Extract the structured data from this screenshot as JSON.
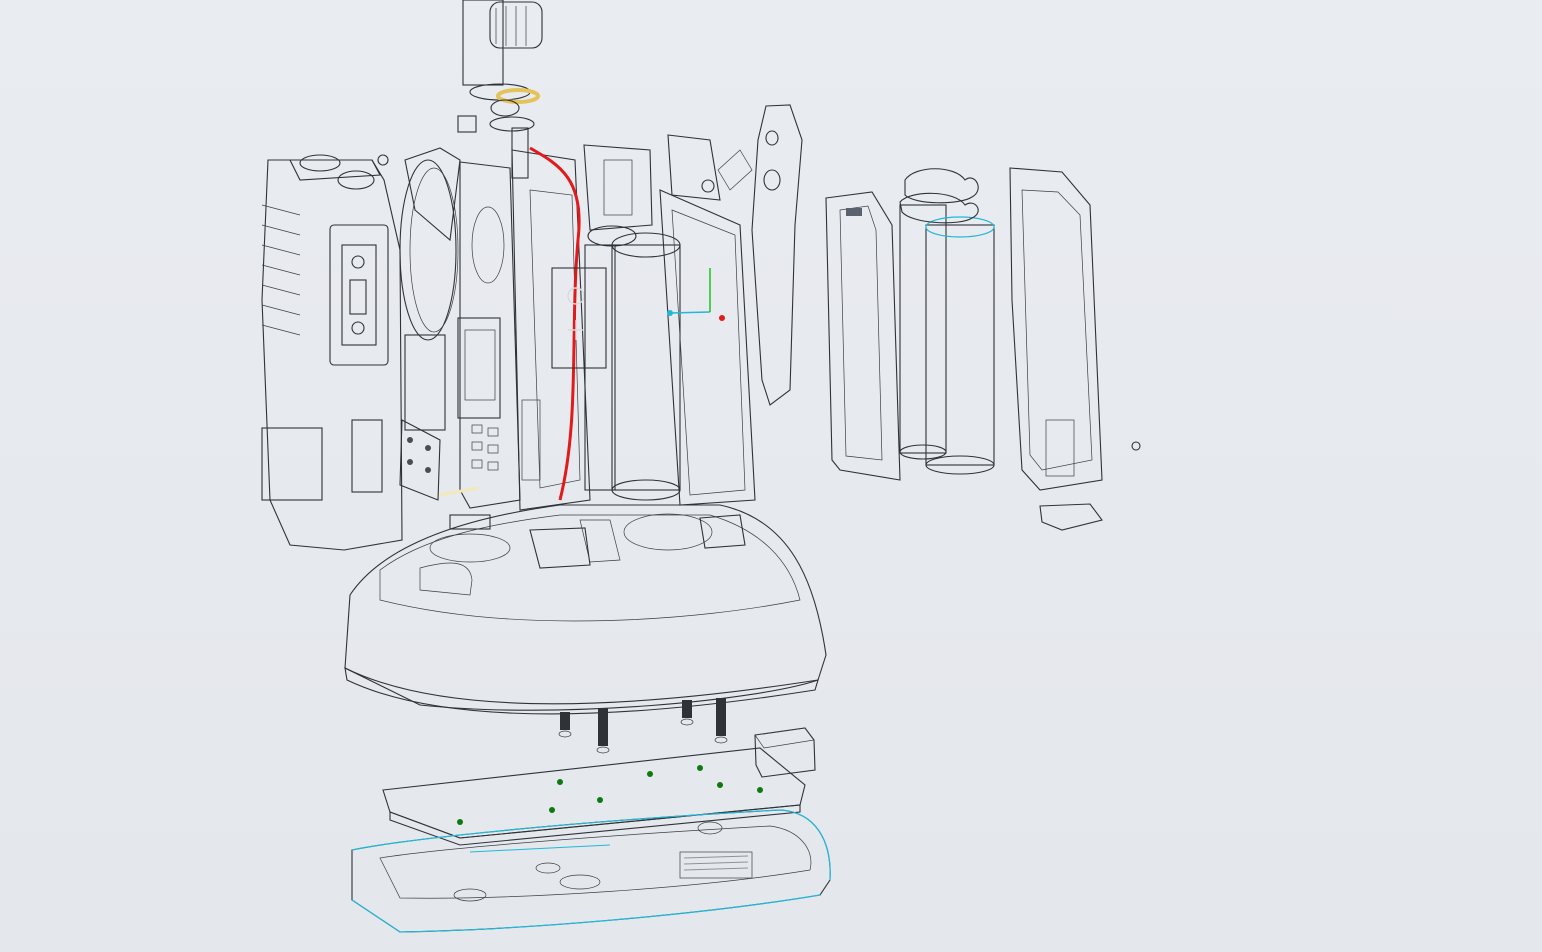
{
  "scene": {
    "background": "#e7eaef",
    "colors": {
      "housing_dark": "#5b5f64",
      "housing_mid": "#7e8287",
      "housing_light": "#a9adb2",
      "battery_blue": "#a3b0c2",
      "pcb_green": "#19c51d",
      "highlight_green": "#33f03a",
      "wire_red": "#e11b1b",
      "selection_cyan": "#22b8d8",
      "brass": "#e3c35a"
    },
    "parts": [
      "knob-assembly",
      "front-housing",
      "speaker",
      "main-pcb",
      "red-wire",
      "inner-frame",
      "label-plate",
      "battery-cell-front",
      "battery-clip-bracket",
      "belt-clip",
      "battery-cover",
      "battery-cell-pair",
      "battery-door",
      "charger-base-top",
      "charger-pins",
      "charger-pcb",
      "charger-connector",
      "charger-base-bottom"
    ]
  }
}
